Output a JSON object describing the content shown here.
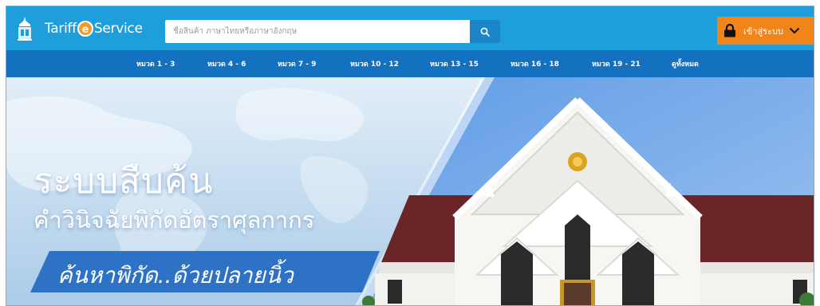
{
  "header": {
    "brand_left": "Tariff",
    "brand_e": "e",
    "brand_right": "Service",
    "search": {
      "placeholder": "ชื่อสินค้า ภาษาไทยหรือภาษาอังกฤษ",
      "value": ""
    },
    "login_label": "เข้าสู่ระบบ"
  },
  "nav": {
    "items": [
      {
        "label": "หมวด 1 - 3"
      },
      {
        "label": "หมวด 4 - 6"
      },
      {
        "label": "หมวด 7 - 9"
      },
      {
        "label": "หมวด 10 - 12"
      },
      {
        "label": "หมวด 13 - 15"
      },
      {
        "label": "หมวด 16 - 18"
      },
      {
        "label": "หมวด 19 - 21"
      },
      {
        "label": "ดูทั้งหมด"
      }
    ]
  },
  "hero": {
    "title": "ระบบสืบค้น",
    "subtitle": "คำวินิจฉัยพิกัดอัตราศุลกากร",
    "tagline": "ค้นหาพิกัด..ด้วยปลายนิ้ว"
  },
  "colors": {
    "topbar": "#1e9fdc",
    "navbar": "#1471c0",
    "login": "#f1851a",
    "search_button": "#1a85c8"
  },
  "icons": {
    "emblem": "customs-emblem-icon",
    "search": "search-icon",
    "lock": "lock-icon",
    "chevron": "chevron-down-icon"
  }
}
